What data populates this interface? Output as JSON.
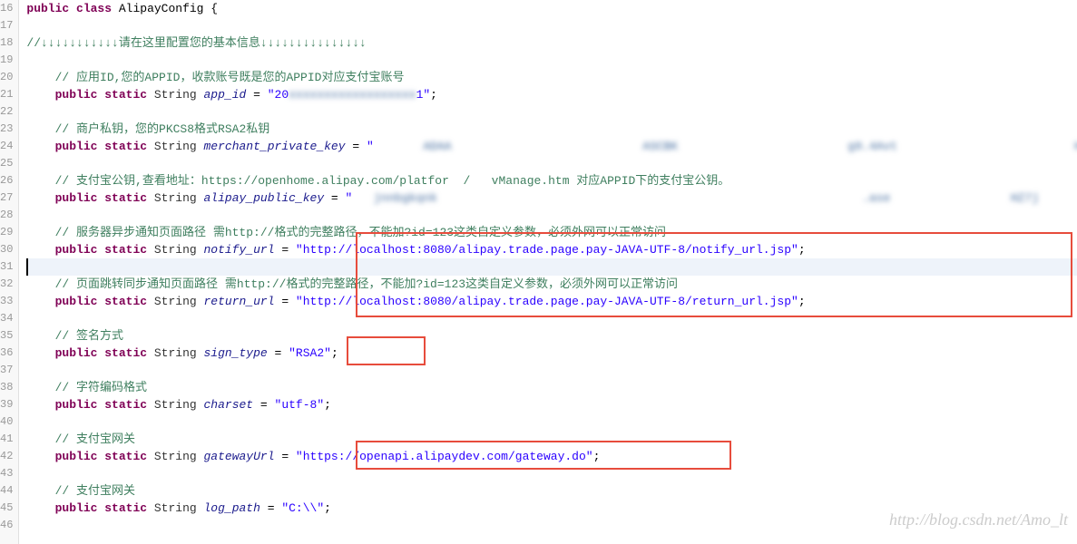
{
  "lines": {
    "start": 16,
    "end": 46
  },
  "code": {
    "l16_kw1": "public",
    "l16_kw2": "class",
    "l16_cls": "AlipayConfig",
    "l16_brace": " {",
    "l18_cmt": "//↓↓↓↓↓↓↓↓↓↓↓请在这里配置您的基本信息↓↓↓↓↓↓↓↓↓↓↓↓↓↓↓",
    "l20_cmt": "// 应用ID,您的APPID，收款账号既是您的APPID对应支付宝账号",
    "l21_kw1": "public",
    "l21_kw2": "static",
    "l21_type": "String",
    "l21_field": "app_id",
    "l21_eq": " = ",
    "l21_str_a": "\"20",
    "l21_str_b": "1\"",
    "l21_semi": ";",
    "l23_cmt": "// 商户私钥，您的PKCS8格式RSA2私钥",
    "l24_field": "merchant_private_key",
    "l24_str": "\"",
    "l26_cmt": "// 支付宝公钥,查看地址：https://openhome.alipay.com/platfor  /   vManage.htm 对应APPID下的支付宝公钥。",
    "l27_field": "alipay_public_key",
    "l27_str": "\"",
    "l29_cmt": "// 服务器异步通知页面路径 需http://格式的完整路径，不能加?id=123这类自定义参数，必须外网可以正常访问",
    "l30_field": "notify_url",
    "l30_str": "\"http://localhost:8080/alipay.trade.page.pay-JAVA-UTF-8/notify_url.jsp\"",
    "l32_cmt": "// 页面跳转同步通知页面路径 需http://格式的完整路径，不能加?id=123这类自定义参数，必须外网可以正常访问",
    "l33_field": "return_url",
    "l33_str": "\"http://localhost:8080/alipay.trade.page.pay-JAVA-UTF-8/return_url.jsp\"",
    "l35_cmt": "// 签名方式",
    "l36_field": "sign_type",
    "l36_str": "\"RSA2\"",
    "l38_cmt": "// 字符编码格式",
    "l39_field": "charset",
    "l39_str": "\"utf-8\"",
    "l41_cmt": "// 支付宝网关",
    "l42_field": "gatewayUrl",
    "l42_str": "\"https://openapi.alipaydev.com/gateway.do\"",
    "l44_cmt": "// 支付宝网关",
    "l45_field": "log_path",
    "l45_str": "\"C:\\\\\""
  },
  "watermark": "http://blog.csdn.net/Amo_lt"
}
